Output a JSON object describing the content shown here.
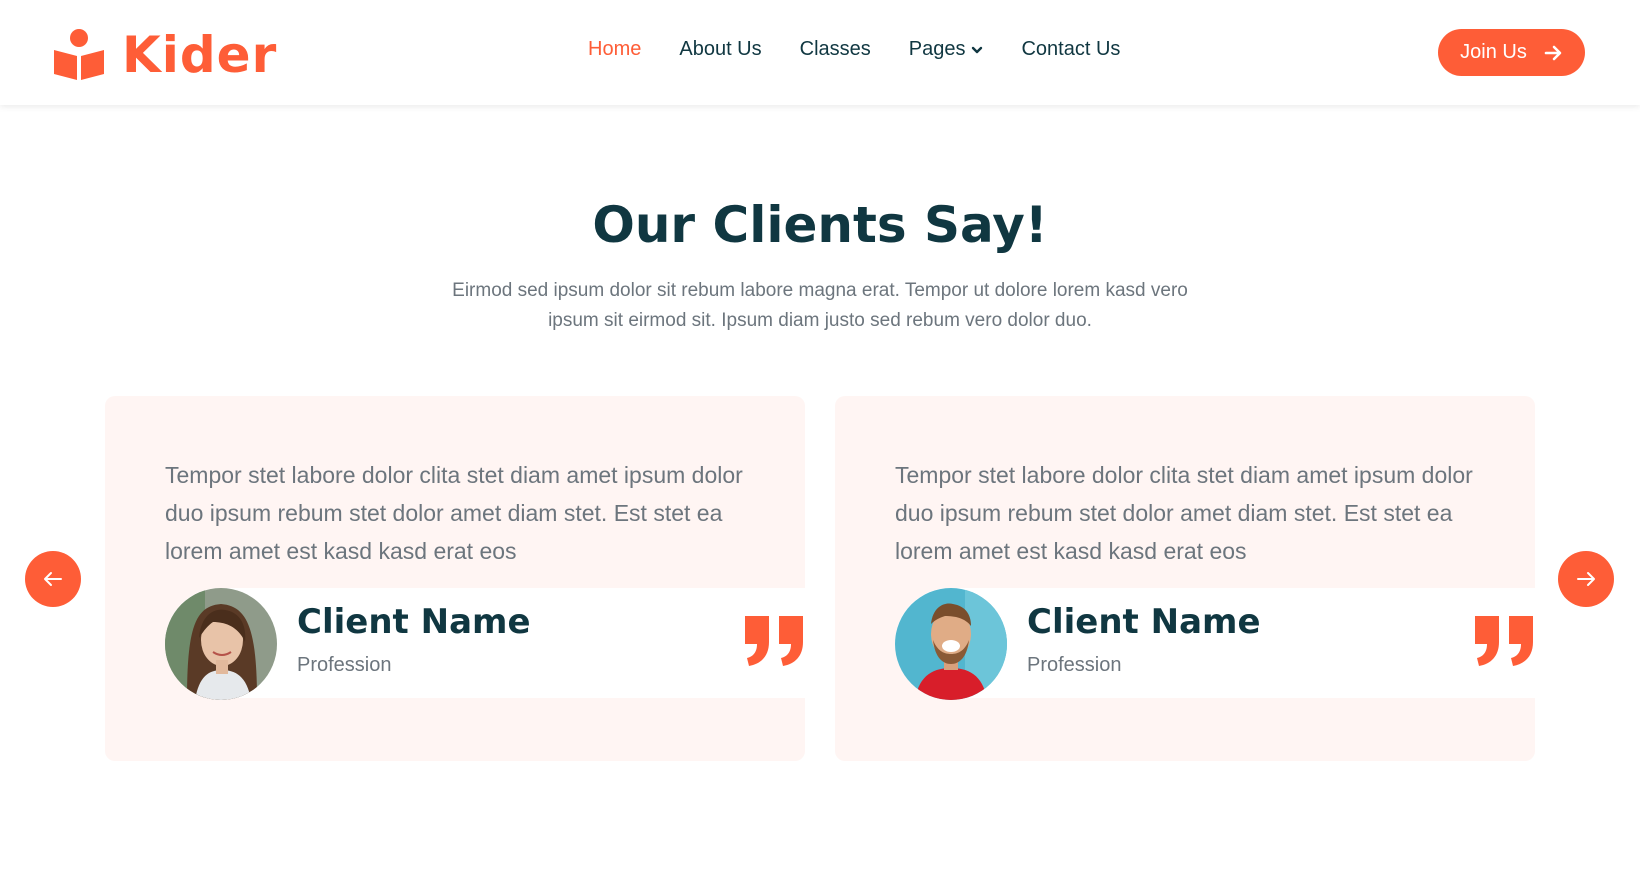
{
  "header": {
    "brand": "Kider",
    "nav": [
      {
        "label": "Home",
        "active": true
      },
      {
        "label": "About Us",
        "active": false
      },
      {
        "label": "Classes",
        "active": false
      },
      {
        "label": "Pages",
        "active": false,
        "dropdown": true
      },
      {
        "label": "Contact Us",
        "active": false
      }
    ],
    "join_label": "Join Us"
  },
  "testimonials": {
    "title": "Our Clients Say!",
    "subtitle": "Eirmod sed ipsum dolor sit rebum labore magna erat. Tempor ut dolore lorem kasd vero ipsum sit eirmod sit. Ipsum diam justo sed rebum vero dolor duo.",
    "items": [
      {
        "text": "Tempor stet labore dolor clita stet diam amet ipsum dolor duo ipsum rebum stet dolor amet diam stet. Est stet ea lorem amet est kasd kasd erat eos",
        "name": "Client Name",
        "profession": "Profession"
      },
      {
        "text": "Tempor stet labore dolor clita stet diam amet ipsum dolor duo ipsum rebum stet dolor amet diam stet. Est stet ea lorem amet est kasd kasd erat eos",
        "name": "Client Name",
        "profession": "Profession"
      }
    ]
  },
  "icons": {
    "brand": "book-reader-icon",
    "join": "arrow-right-icon",
    "prev": "arrow-left-icon",
    "next": "arrow-right-icon",
    "quote": "quote-right-icon"
  },
  "colors": {
    "primary": "#FE5D37",
    "dark": "#103741",
    "muted": "#6c757d",
    "card_bg": "#FFF5F3"
  }
}
